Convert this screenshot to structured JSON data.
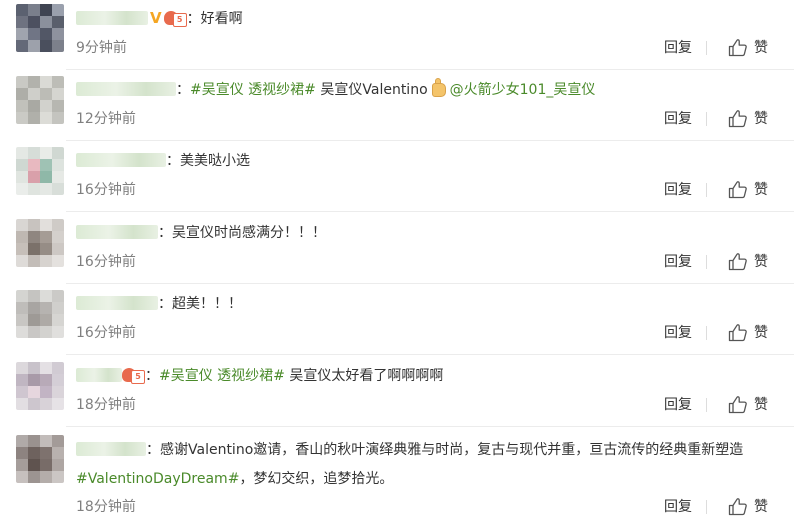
{
  "comments": [
    {
      "time": "9分钟前",
      "badges": "fan-v",
      "segments": [
        {
          "type": "text",
          "value": "：好看啊"
        }
      ],
      "reply": "回复",
      "like": "赞"
    },
    {
      "time": "12分钟前",
      "segments": [
        {
          "type": "text",
          "value": "："
        },
        {
          "type": "topic",
          "value": "#吴宣仪 透视纱裙#"
        },
        {
          "type": "text",
          "value": " 吴宣仪Valentino"
        },
        {
          "type": "emoji",
          "value": "thumbs-up-emoji"
        },
        {
          "type": "mention",
          "value": "@火箭少女101_吴宣仪"
        }
      ],
      "reply": "回复",
      "like": "赞"
    },
    {
      "time": "16分钟前",
      "segments": [
        {
          "type": "text",
          "value": "：美美哒小选"
        }
      ],
      "reply": "回复",
      "like": "赞"
    },
    {
      "time": "16分钟前",
      "segments": [
        {
          "type": "text",
          "value": "：吴宣仪时尚感满分！！！"
        }
      ],
      "reply": "回复",
      "like": "赞"
    },
    {
      "time": "16分钟前",
      "segments": [
        {
          "type": "text",
          "value": "：超美！！！"
        }
      ],
      "reply": "回复",
      "like": "赞"
    },
    {
      "time": "18分钟前",
      "badges": "fan",
      "segments": [
        {
          "type": "text",
          "value": "："
        },
        {
          "type": "topic",
          "value": "#吴宣仪 透视纱裙#"
        },
        {
          "type": "text",
          "value": " 吴宣仪太好看了啊啊啊啊"
        }
      ],
      "reply": "回复",
      "like": "赞"
    },
    {
      "time": "18分钟前",
      "segments": [
        {
          "type": "text",
          "value": "：感谢Valentino邀请，香山的秋叶演绎典雅与时尚，复古与现代并重，亘古流传的经典重新塑造"
        },
        {
          "type": "topic",
          "value": "#ValentinoDayDream#"
        },
        {
          "type": "text",
          "value": "，梦幻交织，追梦拾光。"
        }
      ],
      "reply": "回复",
      "like": "赞"
    }
  ],
  "badge_fan_level": "5",
  "badge_v_glyph": "V",
  "colors": {
    "link": "#4a8a2a",
    "time": "#808080",
    "text": "#333333",
    "badge_v": "#f5a623",
    "badge_fan": "#e86a4d"
  }
}
